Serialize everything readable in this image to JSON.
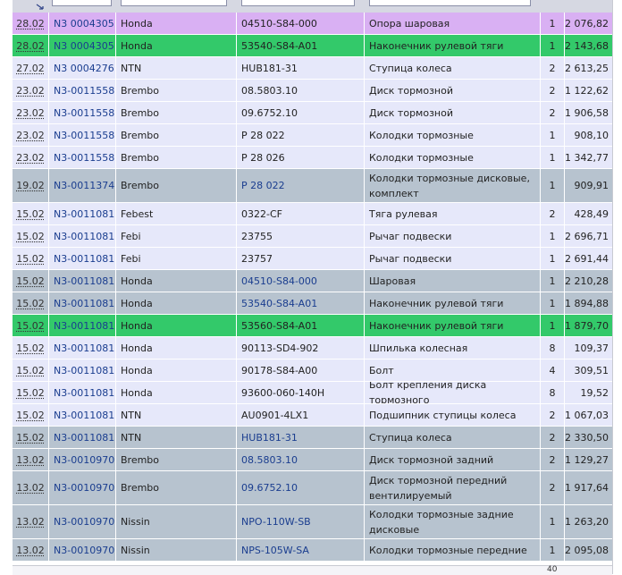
{
  "colors": {
    "pink": "#d9b0f3",
    "green": "#33c96a",
    "light": "#e6e8fa",
    "gray": "#b7c3cf"
  },
  "footer": {
    "page_indicator": "40"
  },
  "rows": [
    {
      "date": "28.02",
      "doc": "N3 0004305",
      "brand": "Honda",
      "code": "04510-S84-000",
      "name": "Опора шаровая",
      "qty": "1",
      "sum": "2 076,82",
      "bg": "pink",
      "link": false
    },
    {
      "date": "28.02",
      "doc": "N3 0004305",
      "brand": "Honda",
      "code": "53540-S84-A01",
      "name": "Наконечник рулевой тяги",
      "qty": "1",
      "sum": "2 143,68",
      "bg": "green",
      "link": false
    },
    {
      "date": "27.02",
      "doc": "N3 0004276",
      "brand": "NTN",
      "code": "HUB181-31",
      "name": "Ступица колеса",
      "qty": "2",
      "sum": "2 613,25",
      "bg": "light",
      "link": false
    },
    {
      "date": "23.02",
      "doc": "N3-0011558",
      "brand": "Brembo",
      "code": "08.5803.10",
      "name": "Диск тормозной",
      "qty": "2",
      "sum": "1 122,62",
      "bg": "light",
      "link": false
    },
    {
      "date": "23.02",
      "doc": "N3-0011558",
      "brand": "Brembo",
      "code": "09.6752.10",
      "name": "Диск тормозной",
      "qty": "2",
      "sum": "1 906,58",
      "bg": "light",
      "link": false
    },
    {
      "date": "23.02",
      "doc": "N3-0011558",
      "brand": "Brembo",
      "code": "P 28 022",
      "name": "Колодки тормозные",
      "qty": "1",
      "sum": "908,10",
      "bg": "light",
      "link": false
    },
    {
      "date": "23.02",
      "doc": "N3-0011558",
      "brand": "Brembo",
      "code": "P 28 026",
      "name": "Колодки тормозные",
      "qty": "1",
      "sum": "1 342,77",
      "bg": "light",
      "link": false
    },
    {
      "date": "19.02",
      "doc": "N3-0011374",
      "brand": "Brembo",
      "code": "P 28 022",
      "name": "Колодки тормозные дисковые, комплект",
      "qty": "1",
      "sum": "909,91",
      "bg": "gray",
      "link": true
    },
    {
      "date": "15.02",
      "doc": "N3-0011081",
      "brand": "Febest",
      "code": "0322-CF",
      "name": "Тяга рулевая",
      "qty": "2",
      "sum": "428,49",
      "bg": "light",
      "link": false
    },
    {
      "date": "15.02",
      "doc": "N3-0011081",
      "brand": "Febi",
      "code": "23755",
      "name": "Рычаг подвески",
      "qty": "1",
      "sum": "2 696,71",
      "bg": "light",
      "link": false
    },
    {
      "date": "15.02",
      "doc": "N3-0011081",
      "brand": "Febi",
      "code": "23757",
      "name": "Рычаг подвески",
      "qty": "1",
      "sum": "2 691,44",
      "bg": "light",
      "link": false
    },
    {
      "date": "15.02",
      "doc": "N3-0011081",
      "brand": "Honda",
      "code": "04510-S84-000",
      "name": "Шаровая",
      "qty": "1",
      "sum": "2 210,28",
      "bg": "gray",
      "link": true
    },
    {
      "date": "15.02",
      "doc": "N3-0011081",
      "brand": "Honda",
      "code": "53540-S84-A01",
      "name": "Наконечник рулевой тяги",
      "qty": "1",
      "sum": "1 894,88",
      "bg": "gray",
      "link": true
    },
    {
      "date": "15.02",
      "doc": "N3-0011081",
      "brand": "Honda",
      "code": "53560-S84-A01",
      "name": "Наконечник рулевой тяги",
      "qty": "1",
      "sum": "1 879,70",
      "bg": "green",
      "link": false
    },
    {
      "date": "15.02",
      "doc": "N3-0011081",
      "brand": "Honda",
      "code": "90113-SD4-902",
      "name": "Шпилька колесная",
      "qty": "8",
      "sum": "109,37",
      "bg": "light",
      "link": false
    },
    {
      "date": "15.02",
      "doc": "N3-0011081",
      "brand": "Honda",
      "code": "90178-S84-A00",
      "name": "Болт",
      "qty": "4",
      "sum": "309,51",
      "bg": "light",
      "link": false
    },
    {
      "date": "15.02",
      "doc": "N3-0011081",
      "brand": "Honda",
      "code": "93600-060-140H",
      "name": "Болт крепления диска тормозного",
      "qty": "8",
      "sum": "19,52",
      "bg": "light",
      "link": false
    },
    {
      "date": "15.02",
      "doc": "N3-0011081",
      "brand": "NTN",
      "code": "AU0901-4LX1",
      "name": "Подшипник ступицы колеса",
      "qty": "2",
      "sum": "1 067,03",
      "bg": "light",
      "link": false
    },
    {
      "date": "15.02",
      "doc": "N3-0011081",
      "brand": "NTN",
      "code": "HUB181-31",
      "name": "Ступица колеса",
      "qty": "2",
      "sum": "2 330,50",
      "bg": "gray",
      "link": true
    },
    {
      "date": "13.02",
      "doc": "N3-0010970",
      "brand": "Brembo",
      "code": "08.5803.10",
      "name": "Диск тормозной задний",
      "qty": "2",
      "sum": "1 129,27",
      "bg": "gray",
      "link": true
    },
    {
      "date": "13.02",
      "doc": "N3-0010970",
      "brand": "Brembo",
      "code": "09.6752.10",
      "name": "Диск тормозной передний вентилируемый",
      "qty": "2",
      "sum": "1 917,64",
      "bg": "gray",
      "link": true
    },
    {
      "date": "13.02",
      "doc": "N3-0010970",
      "brand": "Nissin",
      "code": "NPO-110W-SB",
      "name": "Колодки тормозные задние дисковые",
      "qty": "1",
      "sum": "1 263,20",
      "bg": "gray",
      "link": true
    },
    {
      "date": "13.02",
      "doc": "N3-0010970",
      "brand": "Nissin",
      "code": "NPS-105W-SA",
      "name": "Колодки тормозные передние",
      "qty": "1",
      "sum": "2 095,08",
      "bg": "gray",
      "link": true
    }
  ]
}
